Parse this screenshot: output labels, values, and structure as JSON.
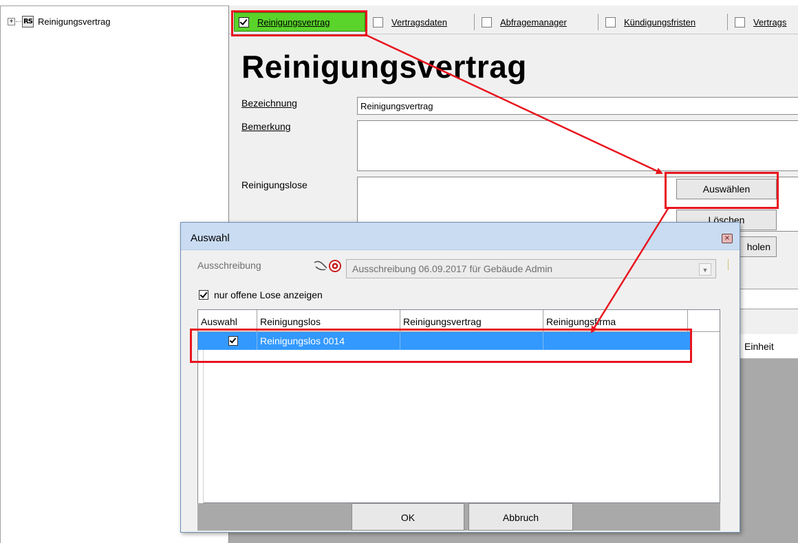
{
  "tree": {
    "expander": "+",
    "icon_text": "RS",
    "label": "Reinigungsvertrag"
  },
  "tabs": [
    {
      "label": "Reinigungsvertrag",
      "checked": true
    },
    {
      "label": "Vertragsdaten",
      "checked": false
    },
    {
      "label": "Abfragemanager",
      "checked": false
    },
    {
      "label": "Kündigungsfristen",
      "checked": false
    },
    {
      "label": "Vertrags",
      "checked": false
    }
  ],
  "form": {
    "title": "Reinigungsvertrag",
    "bezeichnung_label": "Bezeichnung",
    "bezeichnung_value": "Reinigungsvertrag",
    "bemerkung_label": "Bemerkung",
    "bemerkung_value": "",
    "lose_label": "Reinigungslose",
    "btn_auswaehlen": "Auswählen",
    "btn_loeschen": "Löschen",
    "btn_holen": "holen",
    "einheit_header": "Einheit"
  },
  "dialog": {
    "title": "Auswahl",
    "close_symbol": "×",
    "ausschreibung_label": "Ausschreibung",
    "ausschreibung_value": "Ausschreibung 06.09.2017 für Gebäude Admin",
    "nur_offene_label": "nur offene Lose anzeigen",
    "nur_offene_checked": true,
    "columns": [
      "Auswahl",
      "Reinigungslos",
      "Reinigungsvertrag",
      "Reinigungsfirma"
    ],
    "rows": [
      {
        "auswahl": true,
        "reinigungslos": "Reinigungslos 0014",
        "reinigungsvertrag": "",
        "reinigungsfirma": ""
      }
    ],
    "ok_label": "OK",
    "abbruch_label": "Abbruch"
  },
  "colors": {
    "highlight_tab": "#5ad32a",
    "annotation_red": "#e8141e",
    "selection_blue": "#3399ff",
    "dialog_titlebar": "#c9dcf2"
  }
}
